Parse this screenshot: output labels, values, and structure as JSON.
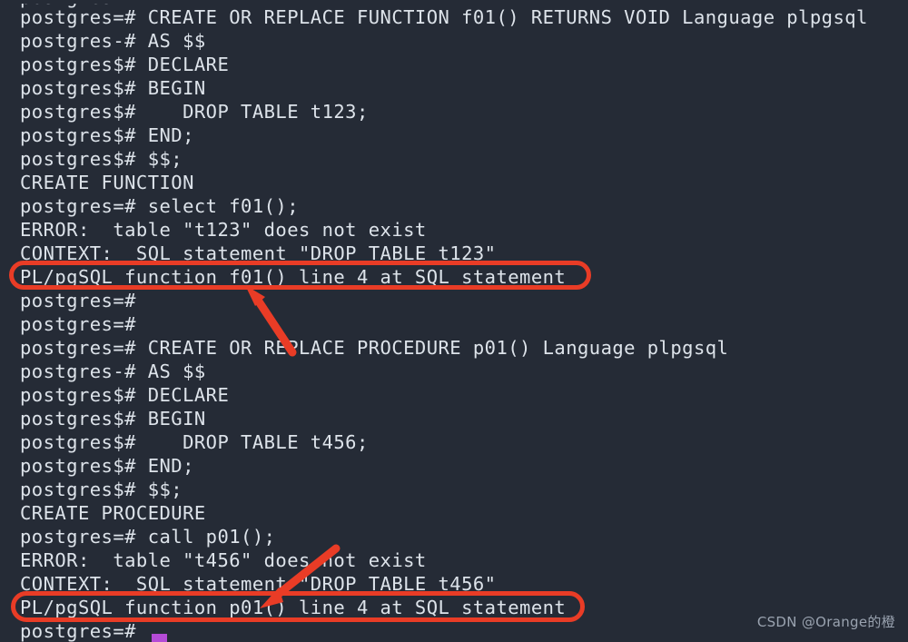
{
  "terminal": {
    "background_color": "#252b36",
    "text_color": "#dde3ea",
    "cursor_color": "#b44bd6",
    "lines": [
      "postgres",
      "postgres=# CREATE OR REPLACE FUNCTION f01() RETURNS VOID Language plpgsql",
      "postgres-# AS $$",
      "postgres$# DECLARE",
      "postgres$# BEGIN",
      "postgres$#    DROP TABLE t123;",
      "postgres$# END;",
      "postgres$# $$;",
      "CREATE FUNCTION",
      "postgres=# select f01();",
      "ERROR:  table \"t123\" does not exist",
      "CONTEXT:  SQL statement \"DROP TABLE t123\"",
      "PL/pgSQL function f01() line 4 at SQL statement",
      "postgres=#",
      "postgres=#",
      "postgres=# CREATE OR REPLACE PROCEDURE p01() Language plpgsql",
      "postgres-# AS $$",
      "postgres$# DECLARE",
      "postgres$# BEGIN",
      "postgres$#    DROP TABLE t456;",
      "postgres$# END;",
      "postgres$# $$;",
      "CREATE PROCEDURE",
      "postgres=# call p01();",
      "ERROR:  table \"t456\" does not exist",
      "CONTEXT:  SQL statement \"DROP TABLE t456\"",
      "PL/pgSQL function p01() line 4 at SQL statement",
      "postgres=#"
    ]
  },
  "annotations": {
    "color": "#e93c26",
    "highlight_boxes": [
      {
        "label": "highlight-function-trace",
        "target_text": "PL/pgSQL function f01() line 4 at SQL statement"
      },
      {
        "label": "highlight-procedure-trace",
        "target_text": "PL/pgSQL function p01() line 4 at SQL statement"
      }
    ],
    "arrows": [
      {
        "label": "arrow-to-function-trace",
        "direction": "up-left"
      },
      {
        "label": "arrow-to-procedure-trace",
        "direction": "down-left"
      }
    ]
  },
  "watermark": {
    "text": "CSDN @Orange的橙",
    "color": "#9aa3b0"
  }
}
